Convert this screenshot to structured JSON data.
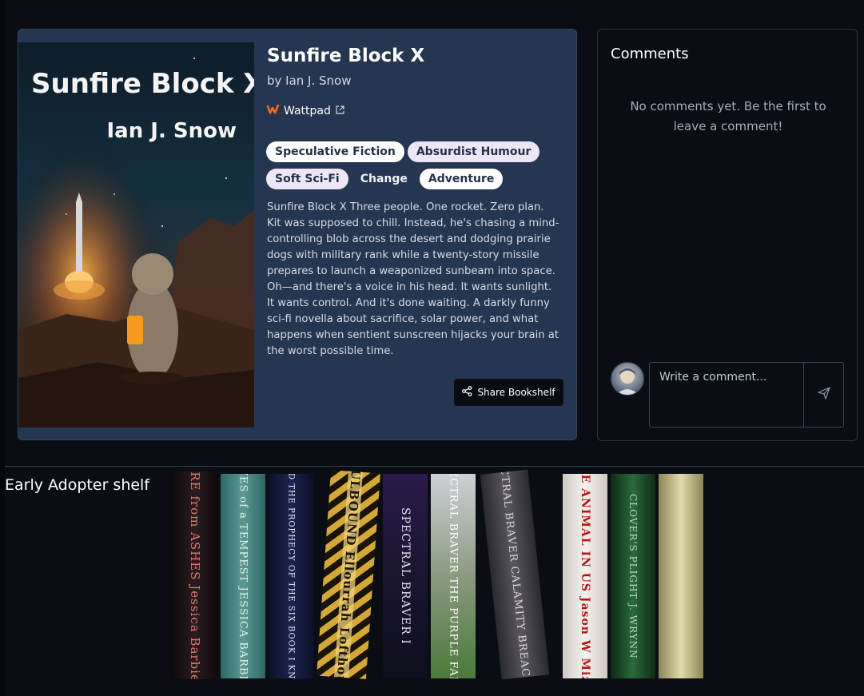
{
  "book": {
    "cover_title": "Sunfire Block X",
    "cover_author": "Ian J. Snow",
    "title": "Sunfire Block X",
    "byline": "by Ian J. Snow",
    "source": {
      "label": "Wattpad",
      "icon": "wattpad-logo-icon",
      "external_icon": "external-link-icon",
      "color": "#ff6b1a"
    },
    "tags": [
      {
        "label": "Speculative Fiction",
        "style": "light"
      },
      {
        "label": "Absurdist Humour",
        "style": "lilac"
      },
      {
        "label": "Soft Sci-Fi",
        "style": "lilac"
      },
      {
        "label": "Change",
        "style": "plain"
      },
      {
        "label": "Adventure",
        "style": "light"
      }
    ],
    "description": "Sunfire Block X Three people. One rocket. Zero plan.  Kit was supposed to chill. Instead, he's chasing a mind-controlling blob across the desert and dodging prairie dogs with military rank while a twenty-story missile prepares to launch a weaponized sunbeam into space. Oh—and there's a voice in his head. It wants sunlight. It wants control. And it's done waiting.  A darkly funny sci-fi novella about sacrifice, solar power, and what happens when sentient sunscreen hijacks your brain at the worst possible time.",
    "share_label": "Share Bookshelf",
    "share_icon": "share-icon"
  },
  "comments": {
    "title": "Comments",
    "empty_text": "No comments yet. Be the first to leave a comment!",
    "input_placeholder": "Write a comment...",
    "send_icon": "send-icon"
  },
  "shelf": {
    "title": "Early Adopter shelf",
    "books": [
      {
        "spine_text": "FIRE from ASHES  Jessica Barbieri",
        "color": "#1c1416"
      },
      {
        "spine_text": "WAVES of a TEMPEST  JESSICA BARBIERI",
        "color": "#3e7a7a"
      },
      {
        "spine_text": "WULFGARD  THE PROPHECY OF THE SIX BOOK I  KNIGHTFALL",
        "color": "#141a3a"
      },
      {
        "spine_text": "SOULBOUND  Ellourrah Lofthouse",
        "color": "#c8a030"
      },
      {
        "spine_text": "SPECTRAL BRAVER  I",
        "color": "#221c3c"
      },
      {
        "spine_text": "SPECTRAL BRAVER THE PURPLE FAR  II",
        "color": "#8a9a7a"
      },
      {
        "spine_text": "SPECTRAL BRAVER CALAMITY BREACH  III",
        "color": "#3a3a40"
      },
      {
        "spine_text": "THE ANIMAL IN US  Jason W Mizer",
        "color": "#e6e2dc"
      },
      {
        "spine_text": "CLOVER'S PLIGHT  J. WRYNN",
        "color": "#1e4a2a"
      },
      {
        "spine_text": "",
        "color": "#c8c090"
      }
    ]
  }
}
